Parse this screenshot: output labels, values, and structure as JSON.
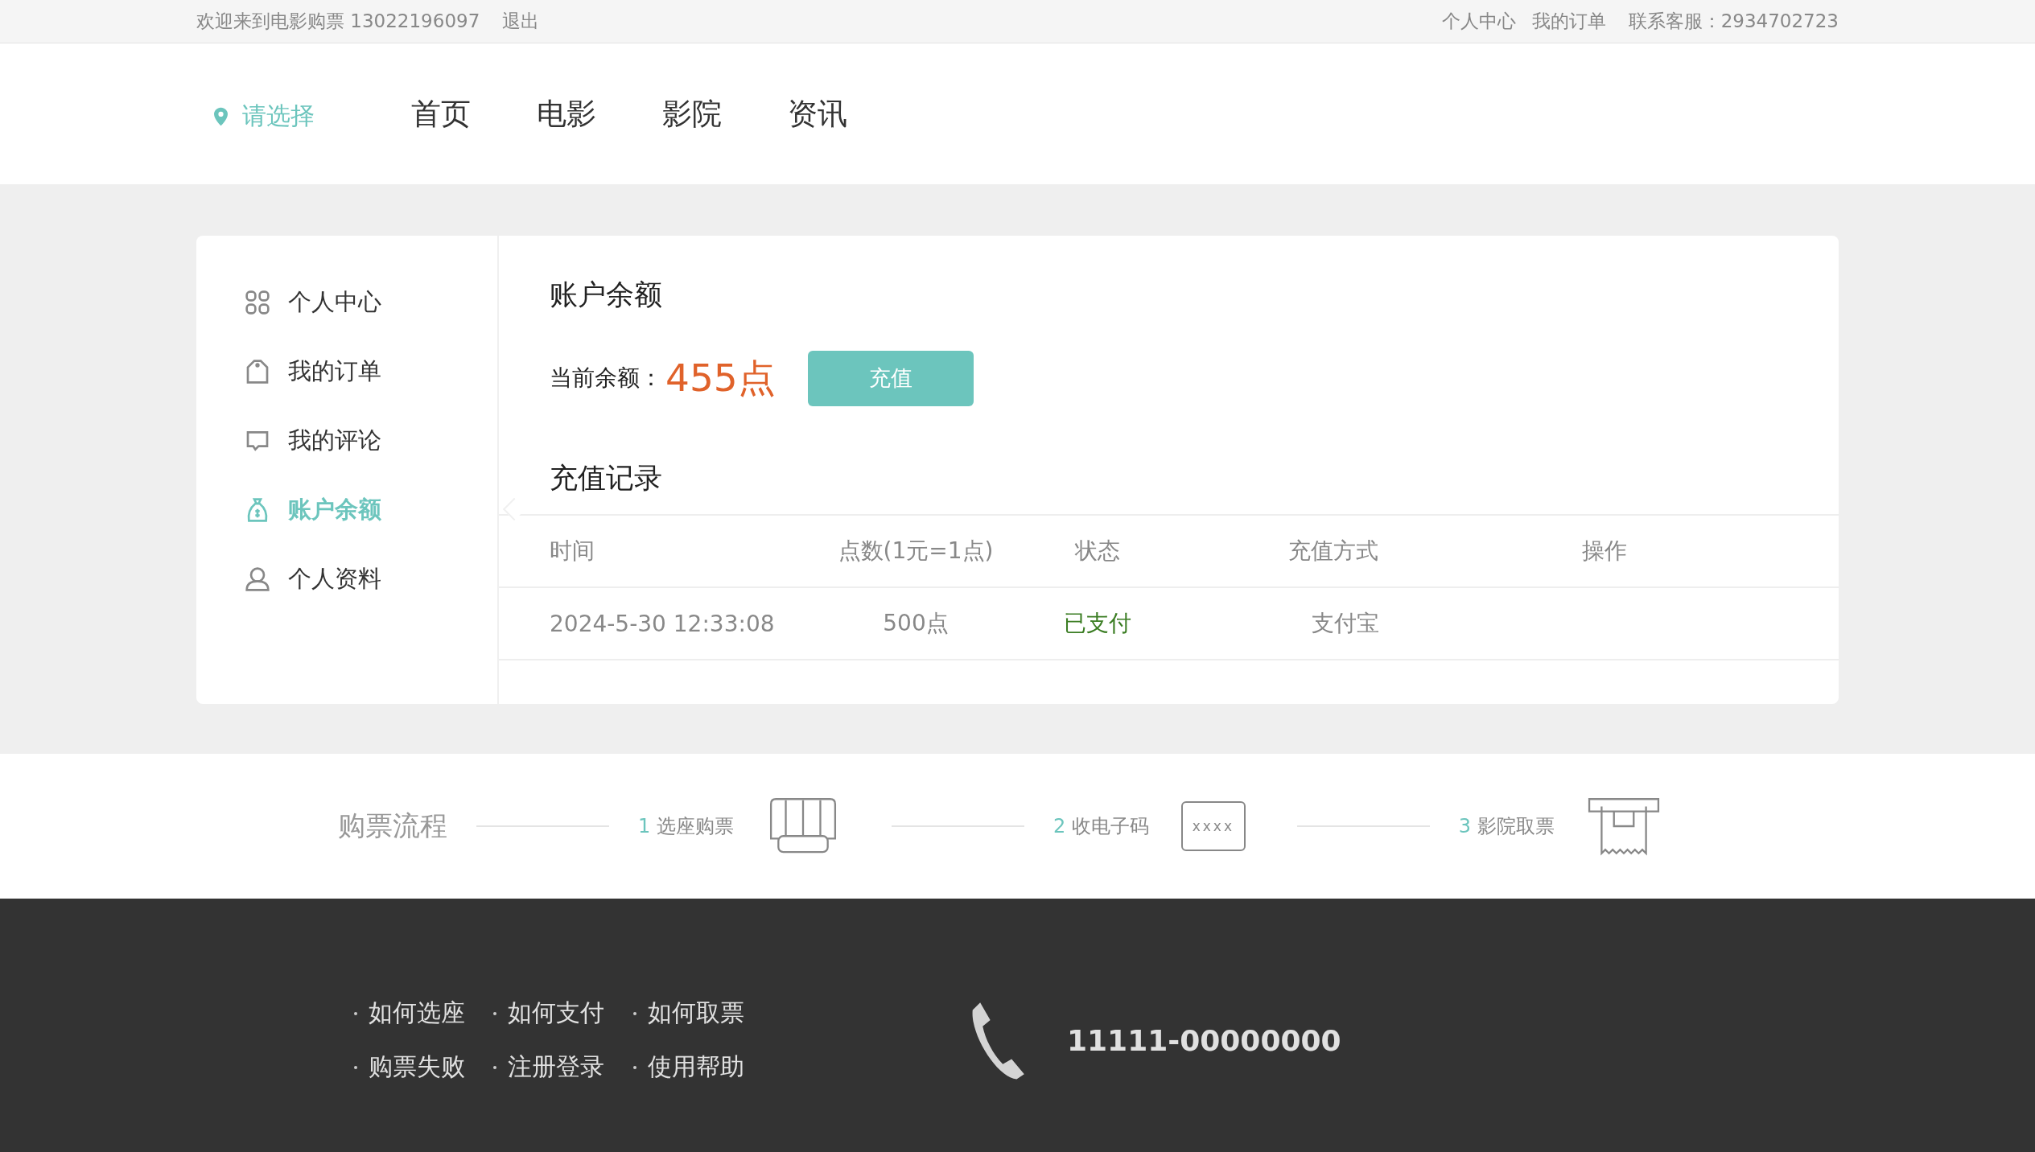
{
  "top_bar": {
    "welcome": "欢迎来到电影购票 13022196097",
    "logout": "退出",
    "links": [
      "个人中心",
      "我的订单"
    ],
    "service": "联系客服：2934702723"
  },
  "header": {
    "location": "请选择",
    "nav": [
      {
        "label": "首页",
        "selected": false
      },
      {
        "label": "电影",
        "selected": false
      },
      {
        "label": "影院",
        "selected": false
      },
      {
        "label": "资讯",
        "selected": false
      }
    ]
  },
  "sidebar": {
    "items": [
      {
        "label": "个人中心",
        "selected": false
      },
      {
        "label": "我的订单",
        "selected": false
      },
      {
        "label": "我的评论",
        "selected": false
      },
      {
        "label": "账户余额",
        "selected": true
      },
      {
        "label": "个人资料",
        "selected": false
      }
    ]
  },
  "balance": {
    "title": "账户余额",
    "label": "当前余额：",
    "amount": "455点",
    "button": "充值"
  },
  "records": {
    "title": "充值记录",
    "columns": [
      "时间",
      "点数(1元=1点)",
      "状态",
      "充值方式",
      "操作"
    ],
    "rows": [
      {
        "time": "2024-5-30 12:33:08",
        "points": "500点",
        "status": "已支付",
        "method": "支付宝"
      }
    ]
  },
  "process": {
    "title": "购票流程",
    "steps": [
      {
        "number": "1",
        "label": "选座购票"
      },
      {
        "number": "2",
        "label": "收电子码",
        "icon_text": "xxxx"
      },
      {
        "number": "3",
        "label": "影院取票"
      }
    ]
  },
  "footer": {
    "links": [
      "如何选座",
      "如何支付",
      "如何取票",
      "购票失败",
      "注册登录",
      "使用帮助"
    ],
    "phone": "11111-00000000"
  }
}
